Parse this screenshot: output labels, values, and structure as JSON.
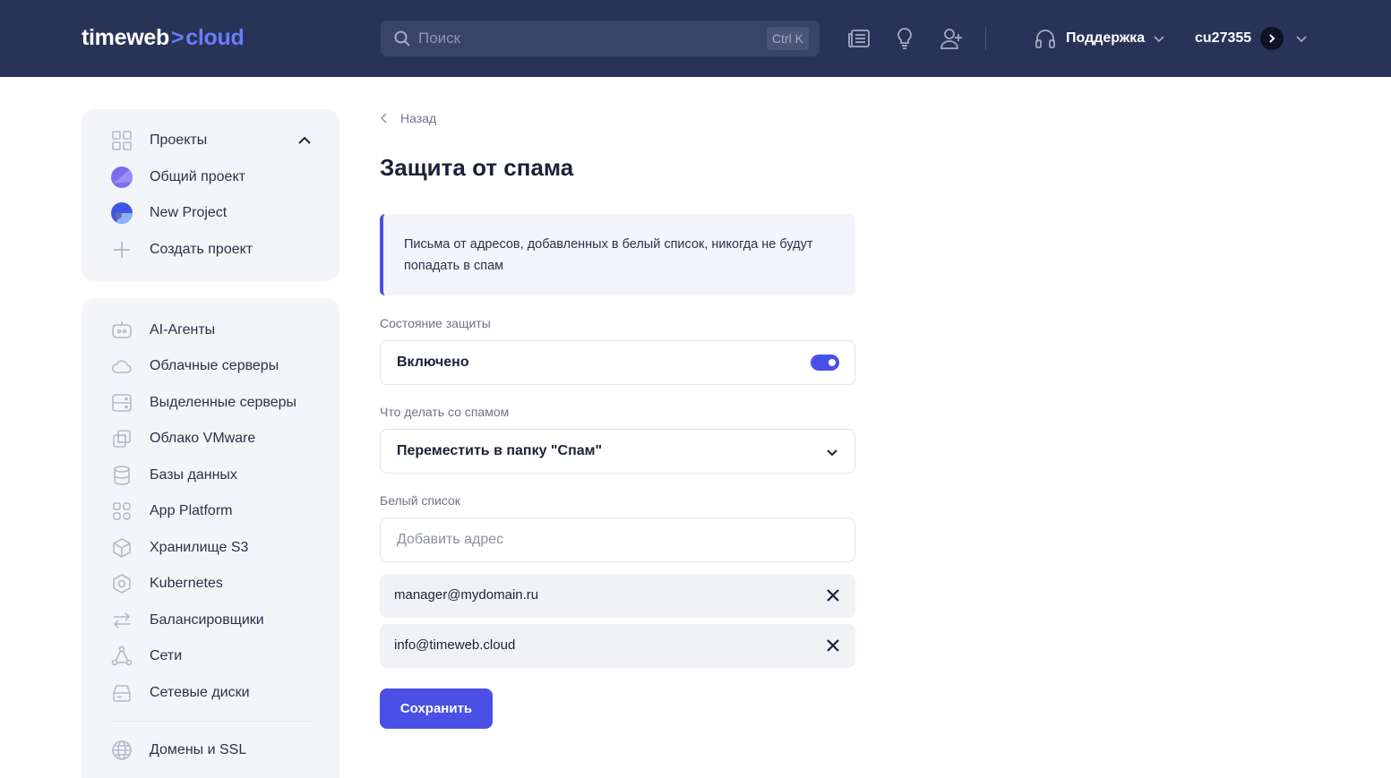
{
  "header": {
    "logo_left": "timeweb",
    "logo_sep": ">",
    "logo_right": "cloud",
    "search_placeholder": "Поиск",
    "search_shortcut": "Ctrl K",
    "support_label": "Поддержка",
    "user_name": "cu27355",
    "icons": [
      "news-icon",
      "lightbulb-icon",
      "add-user-icon"
    ]
  },
  "sidebar": {
    "projects_title": "Проекты",
    "projects": [
      {
        "label": "Общий проект",
        "color": "#7b6cf0"
      },
      {
        "label": "New Project",
        "color": "#3f57e8"
      }
    ],
    "create_project": "Создать проект",
    "nav": [
      {
        "label": "AI-Агенты",
        "icon": "robot-icon"
      },
      {
        "label": "Облачные серверы",
        "icon": "cloud-icon"
      },
      {
        "label": "Выделенные серверы",
        "icon": "server-icon"
      },
      {
        "label": "Облако VMware",
        "icon": "vmware-icon"
      },
      {
        "label": "Базы данных",
        "icon": "database-icon"
      },
      {
        "label": "App Platform",
        "icon": "apps-icon"
      },
      {
        "label": "Хранилище S3",
        "icon": "cube-icon"
      },
      {
        "label": "Kubernetes",
        "icon": "kubernetes-icon"
      },
      {
        "label": "Балансировщики",
        "icon": "balancer-icon"
      },
      {
        "label": "Сети",
        "icon": "network-icon"
      },
      {
        "label": "Сетевые диски",
        "icon": "disk-icon"
      }
    ],
    "domains": {
      "label": "Домены и SSL",
      "icon": "globe-icon"
    }
  },
  "main": {
    "back_label": "Назад",
    "title": "Защита от спама",
    "info_text": "Письма от адресов, добавленных в белый список, никогда не будут попадать в спам",
    "protection_label": "Состояние защиты",
    "protection_value": "Включено",
    "protection_enabled": true,
    "action_label": "Что делать со спамом",
    "action_value": "Переместить в папку \"Спам\"",
    "whitelist_label": "Белый список",
    "whitelist_placeholder": "Добавить адрес",
    "whitelist": [
      "manager@mydomain.ru",
      "info@timeweb.cloud"
    ],
    "save_label": "Сохранить"
  },
  "colors": {
    "topbar": "#283357",
    "accent": "#4a50e6",
    "sidebar_bg": "#f4f5f9"
  }
}
